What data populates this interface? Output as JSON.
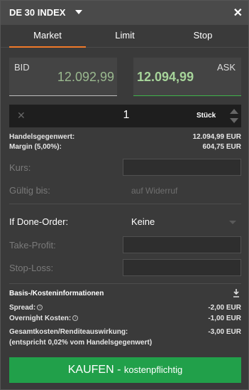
{
  "header": {
    "title": "DE 30 INDEX",
    "close_symbol": "✕"
  },
  "tabs": [
    {
      "label": "Market",
      "active": true
    },
    {
      "label": "Limit",
      "active": false
    },
    {
      "label": "Stop",
      "active": false
    }
  ],
  "quotes": {
    "bid": {
      "label": "BID",
      "price": "12.092,99"
    },
    "ask": {
      "label": "ASK",
      "price": "12.094,99"
    }
  },
  "quantity": {
    "clear_symbol": "✕",
    "value": "1",
    "unit": "Stück"
  },
  "summary": {
    "handelsgegenwert_label": "Handelsgegenwert:",
    "handelsgegenwert_value": "12.094,99 EUR",
    "margin_label": "Margin (5,00%):",
    "margin_value": "604,75 EUR"
  },
  "fields": {
    "kurs_label": "Kurs:",
    "gueltig_label": "Gültig bis:",
    "gueltig_value": "auf Widerruf",
    "if_done_label": "If Done-Order:",
    "if_done_value": "Keine",
    "take_profit_label": "Take-Profit:",
    "stop_loss_label": "Stop-Loss:"
  },
  "costs": {
    "title": "Basis-/Kosteninformationen",
    "spread_label": "Spread:",
    "spread_value": "-2,00 EUR",
    "overnight_label": "Overnight Kosten:",
    "overnight_value": "-1,00 EUR",
    "total_label": "Gesamtkosten/Renditeauswirkung:",
    "total_value": "-3,00 EUR",
    "total_note": "(entspricht 0,02% vom Handelsgegenwert)",
    "info_symbol": "i"
  },
  "buy_button": {
    "label": "KAUFEN",
    "separator": " - ",
    "sublabel": "kostenpflichtig"
  },
  "colors": {
    "accent": "#f07a2a",
    "buy": "#21a04a",
    "ask_underline": "#3fb34a"
  }
}
